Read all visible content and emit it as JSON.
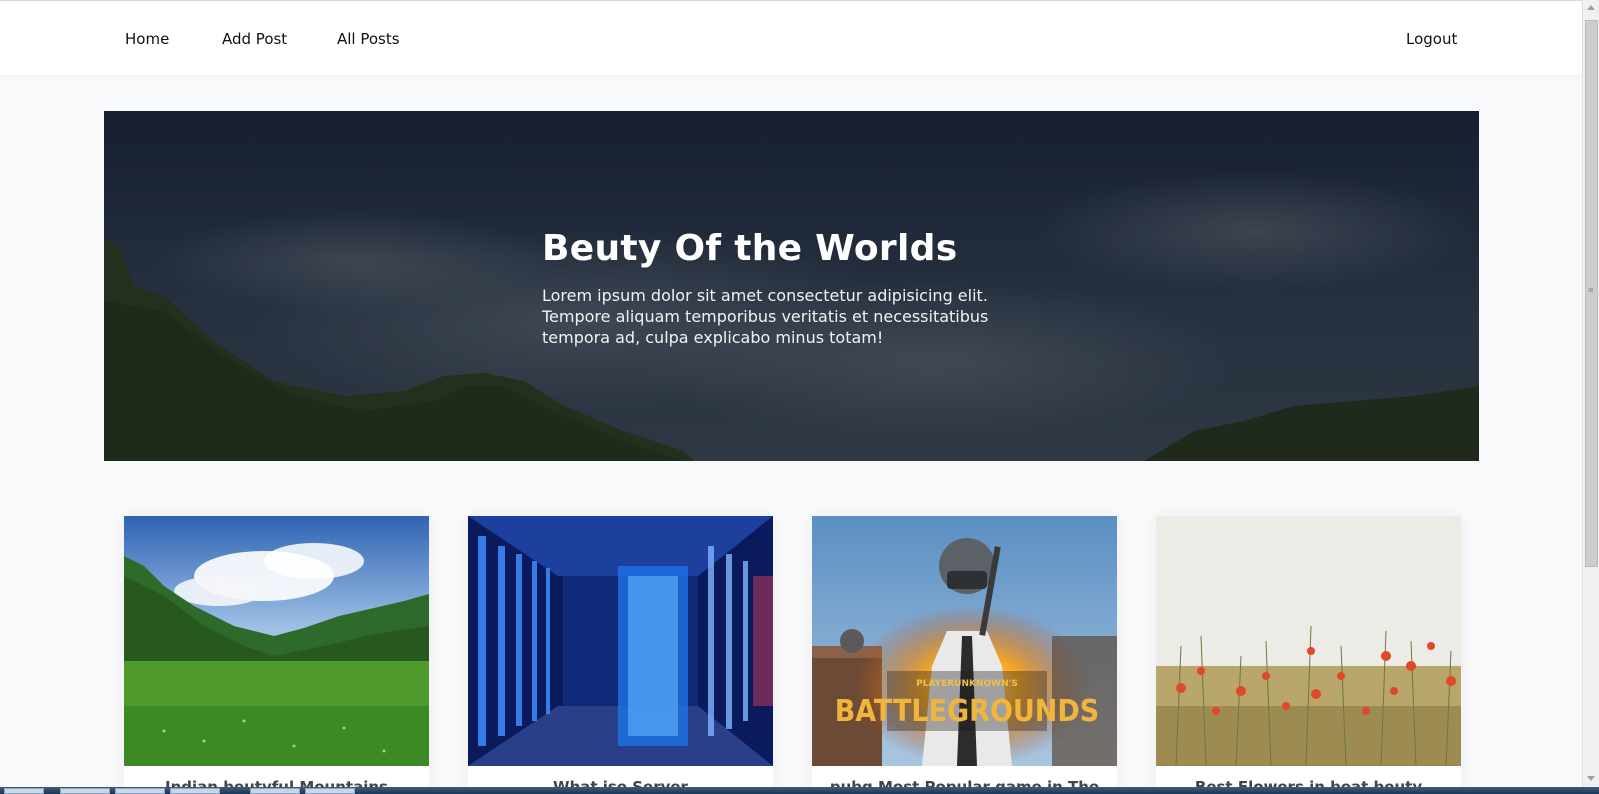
{
  "nav": {
    "home": "Home",
    "add_post": "Add Post",
    "all_posts": "All Posts",
    "logout": "Logout"
  },
  "hero": {
    "title": "Beuty Of the Worlds",
    "description": "Lorem ipsum dolor sit amet consectetur adipisicing elit. Tempore aliquam temporibus veritatis et necessitatibus tempora ad, culpa explicabo minus totam!"
  },
  "cards": [
    {
      "title": "Indian beutyful Mountains",
      "image": "mountain-meadow-photo"
    },
    {
      "title": "What ise Server",
      "image": "server-room-photo"
    },
    {
      "title": "pubg Most Popular game in The",
      "image": "pubg-battlegrounds-photo",
      "logo_text": "PLAYERUNKNOWN'S BATTLEGROUNDS"
    },
    {
      "title": "Best Flowers in beat beuty",
      "image": "poppy-field-photo"
    }
  ],
  "colors": {
    "navbar_bg": "#ffffff",
    "page_bg": "#f8f9fb",
    "hero_overlay": "#1e2a3d"
  }
}
